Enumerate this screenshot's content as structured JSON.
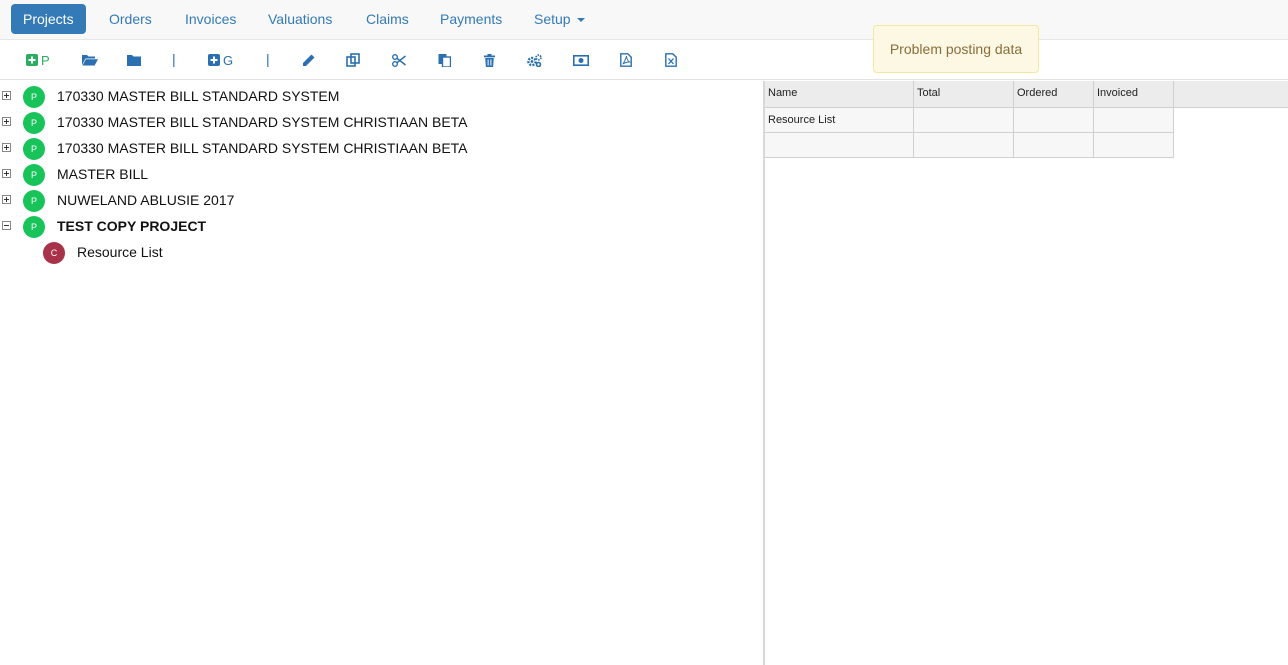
{
  "nav": {
    "items": [
      {
        "label": "Projects",
        "active": true
      },
      {
        "label": "Orders"
      },
      {
        "label": "Invoices"
      },
      {
        "label": "Valuations"
      },
      {
        "label": "Claims"
      },
      {
        "label": "Payments"
      },
      {
        "label": "Setup",
        "dropdown": true
      }
    ]
  },
  "toolbar": {
    "add_project_label": "P",
    "add_group_label": "G",
    "separator": "|"
  },
  "toast": {
    "message": "Problem posting data",
    "color": "#fcf8e3"
  },
  "tree": {
    "project_badge": "P",
    "cost_badge": "C",
    "nodes": [
      {
        "label": "170330 MASTER BILL STANDARD SYSTEM",
        "expanded": false
      },
      {
        "label": "170330 MASTER BILL STANDARD SYSTEM CHRISTIAAN BETA",
        "expanded": false
      },
      {
        "label": "170330 MASTER BILL STANDARD SYSTEM CHRISTIAAN BETA",
        "expanded": false
      },
      {
        "label": "MASTER BILL",
        "expanded": false
      },
      {
        "label": "NUWELAND ABLUSIE 2017",
        "expanded": false
      },
      {
        "label": "TEST COPY PROJECT",
        "expanded": true,
        "selected": true
      },
      {
        "label": "Resource List",
        "child": true
      }
    ]
  },
  "grid": {
    "columns": [
      "Name",
      "Total",
      "Ordered",
      "Invoiced"
    ],
    "rows": [
      [
        "Resource List",
        "",
        "",
        ""
      ],
      [
        "",
        "",
        "",
        ""
      ]
    ]
  },
  "colors": {
    "accent": "#337ab7",
    "project_badge": "#18c45a",
    "cost_badge": "#a8324a"
  }
}
